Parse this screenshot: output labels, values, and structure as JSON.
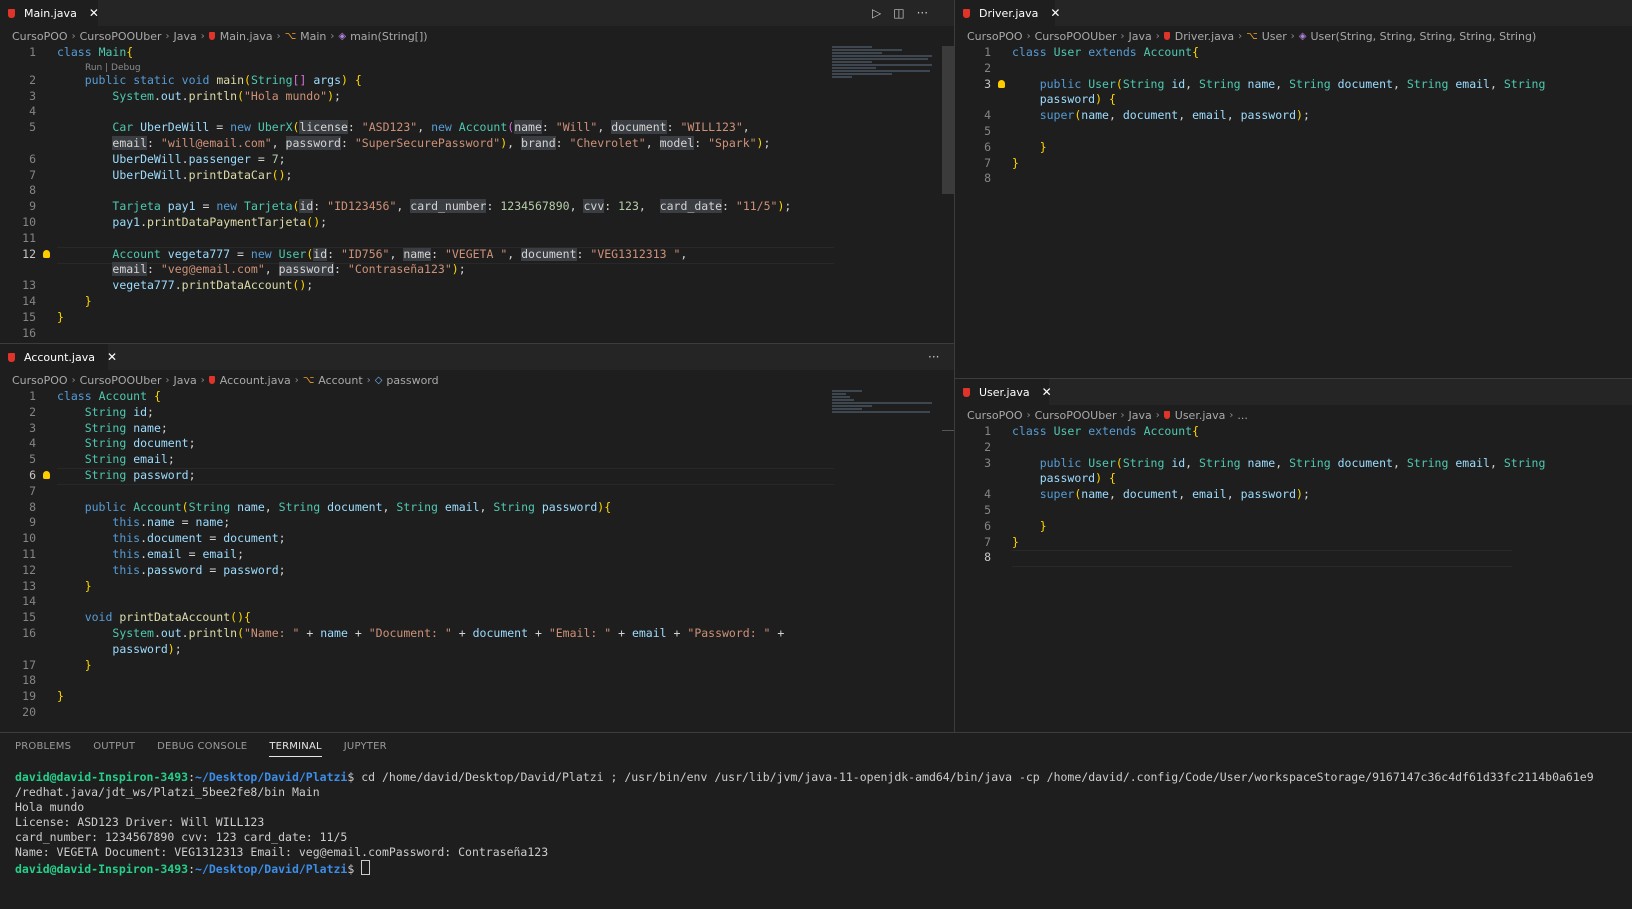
{
  "colors": {
    "editor_bg": "#1e1e1e",
    "tab_bar": "#252526",
    "java_icon": "#e0342b",
    "terminal_user": "#23d18b",
    "terminal_path": "#3b8eea"
  },
  "icons": [
    "java-file-icon",
    "run-icon",
    "split-editor-icon",
    "more-actions-icon",
    "close-icon",
    "lightbulb-icon",
    "class-icon",
    "method-icon",
    "field-icon"
  ],
  "main_editor": {
    "tab": "Main.java",
    "breadcrumb": [
      "CursoPOO",
      "CursoPOOUber",
      "Java",
      "Main.java",
      "Main",
      "main(String[])"
    ],
    "codelens": "Run | Debug",
    "line_numbers": [
      "1",
      "2",
      "3",
      "4",
      "5",
      "",
      "6",
      "7",
      "8",
      "9",
      "10",
      "11",
      "12",
      "",
      "13",
      "14",
      "15",
      "16"
    ],
    "lines": [
      "class Main{",
      "    public static void main(String[] args) {",
      "        System.out.println(\"Hola mundo\");",
      "",
      "        Car UberDeWill = new UberX(license: \"ASD123\", new Account(name: \"Will\", document: \"WILL123\",",
      "        email: \"will@email.com\", password: \"SuperSecurePassword\"), brand: \"Chevrolet\", model: \"Spark\");",
      "        UberDeWill.passenger = 7;",
      "        UberDeWill.printDataCar();",
      "",
      "        Tarjeta pay1 = new Tarjeta(id: \"ID123456\", card_number: 1234567890, cvv: 123,  card_date: \"11/5\");",
      "        pay1.printDataPaymentTarjeta();",
      "",
      "        Account vegeta777 = new User(id: \"ID756\", name: \"VEGETA \", document: \"VEG1312313 \",",
      "        email: \"veg@email.com\", password: \"Contraseña123\");",
      "        vegeta777.printDataAccount();",
      "    }",
      "}",
      ""
    ]
  },
  "account_editor": {
    "tab": "Account.java",
    "breadcrumb": [
      "CursoPOO",
      "CursoPOOUber",
      "Java",
      "Account.java",
      "Account",
      "password"
    ],
    "line_numbers": [
      "1",
      "2",
      "3",
      "4",
      "5",
      "6",
      "7",
      "8",
      "9",
      "10",
      "11",
      "12",
      "13",
      "14",
      "15",
      "16",
      "",
      "17",
      "18",
      "19",
      "20"
    ],
    "lines": [
      "class Account {",
      "    String id;",
      "    String name;",
      "    String document;",
      "    String email;",
      "    String password;",
      "",
      "    public Account(String name, String document, String email, String password){",
      "        this.name = name;",
      "        this.document = document;",
      "        this.email = email;",
      "        this.password = password;",
      "    }",
      "",
      "    void printDataAccount(){",
      "        System.out.println(\"Name: \" + name + \"Document: \" + document + \"Email: \" + email + \"Password: \" +",
      "        password);",
      "    }",
      "",
      "}",
      ""
    ]
  },
  "driver_editor": {
    "tab": "Driver.java",
    "breadcrumb": [
      "CursoPOO",
      "CursoPOOUber",
      "Java",
      "Driver.java",
      "User",
      "User(String, String, String, String, String)"
    ],
    "line_numbers": [
      "1",
      "2",
      "3",
      "",
      "4",
      "5",
      "6",
      "7",
      "8"
    ],
    "lines": [
      "class User extends Account{",
      "",
      "    public User(String id, String name, String document, String email, String",
      "    password) {",
      "    super(name, document, email, password);",
      "",
      "    }",
      "}",
      ""
    ]
  },
  "user_editor": {
    "tab": "User.java",
    "breadcrumb": [
      "CursoPOO",
      "CursoPOOUber",
      "Java",
      "User.java",
      "..."
    ],
    "line_numbers": [
      "1",
      "2",
      "3",
      "",
      "4",
      "5",
      "6",
      "7",
      "8"
    ],
    "lines": [
      "class User extends Account{",
      "",
      "    public User(String id, String name, String document, String email, String",
      "    password) {",
      "    super(name, document, email, password);",
      "",
      "    }",
      "}",
      ""
    ]
  },
  "panel": {
    "tabs": [
      "PROBLEMS",
      "OUTPUT",
      "DEBUG CONSOLE",
      "TERMINAL",
      "JUPYTER"
    ],
    "active_tab": "TERMINAL"
  },
  "terminal": {
    "prompt_user": "david@david-Inspiron-3493",
    "prompt_path": "~/Desktop/David/Platzi",
    "prompt_suffix": "$",
    "command": " cd /home/david/Desktop/David/Platzi ; /usr/bin/env /usr/lib/jvm/java-11-openjdk-amd64/bin/java -cp /home/david/.config/Code/User/workspaceStorage/9167147c36c4df61d33fc2114b0a61e9",
    "command_cont": "/redhat.java/jdt_ws/Platzi_5bee2fe8/bin Main",
    "output": [
      "Hola mundo",
      "License: ASD123 Driver: Will WILL123",
      "card_number: 1234567890 cvv: 123 card_date: 11/5",
      "Name: VEGETA Document: VEG1312313 Email: veg@email.comPassword: Contraseña123"
    ]
  }
}
